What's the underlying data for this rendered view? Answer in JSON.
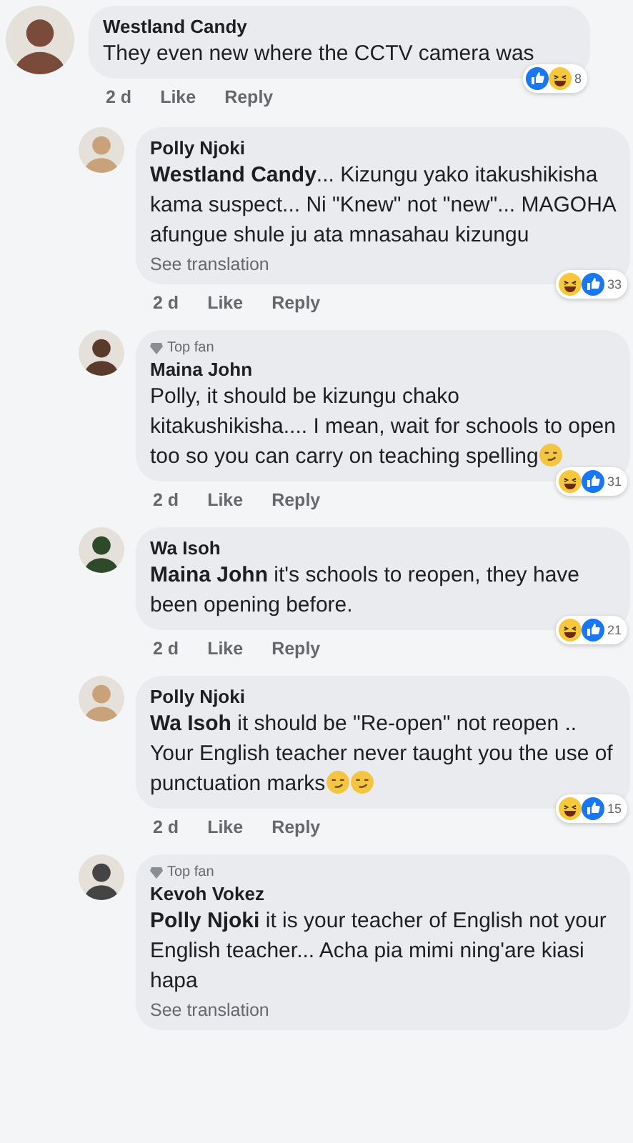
{
  "comments": [
    {
      "name": "Westland Candy",
      "top_fan": false,
      "text": "They even new where the CCTV camera was",
      "time": "2 d",
      "like": "Like",
      "reply": "Reply",
      "reactions": [
        {
          "kind": "like"
        },
        {
          "kind": "haha"
        }
      ],
      "reaction_count": "8",
      "children": [
        {
          "name": "Polly Njoki",
          "top_fan": false,
          "text": "**Westland Candy**... Kizungu yako itakushikisha kama suspect... Ni \"Knew\" not \"new\"... MAGOHA  afungue shule ju ata mnasahau kizungu",
          "see_translation": "See translation",
          "time": "2 d",
          "like": "Like",
          "reply": "Reply",
          "reactions": [
            {
              "kind": "haha"
            },
            {
              "kind": "like"
            }
          ],
          "reaction_count": "33"
        },
        {
          "name": "Maina John",
          "top_fan": true,
          "top_fan_label": "Top fan",
          "text": "Polly, it should be kizungu chako kitakushikisha.... I mean, wait for schools to open too so you can carry on teaching spelling",
          "emoji_after": [
            {
              "kind": "smirk"
            }
          ],
          "time": "2 d",
          "like": "Like",
          "reply": "Reply",
          "reactions": [
            {
              "kind": "haha"
            },
            {
              "kind": "like"
            }
          ],
          "reaction_count": "31"
        },
        {
          "name": "Wa Isoh",
          "top_fan": false,
          "text": "**Maina John** it's schools to reopen, they have been opening before.",
          "time": "2 d",
          "like": "Like",
          "reply": "Reply",
          "reactions": [
            {
              "kind": "haha"
            },
            {
              "kind": "like"
            }
          ],
          "reaction_count": "21"
        },
        {
          "name": "Polly Njoki",
          "top_fan": false,
          "text": "**Wa Isoh** it should be \"Re-open\"  not reopen .. Your English teacher never taught you the use of punctuation marks",
          "emoji_after": [
            {
              "kind": "smirk"
            },
            {
              "kind": "smirk"
            }
          ],
          "time": "2 d",
          "like": "Like",
          "reply": "Reply",
          "reactions": [
            {
              "kind": "haha"
            },
            {
              "kind": "like"
            }
          ],
          "reaction_count": "15"
        },
        {
          "name": "Kevoh Vokez",
          "top_fan": true,
          "top_fan_label": "Top fan",
          "text": "**Polly Njoki** it is your teacher of English not your English teacher... Acha pia mimi ning'are kiasi hapa",
          "see_translation": "See translation"
        }
      ]
    }
  ]
}
